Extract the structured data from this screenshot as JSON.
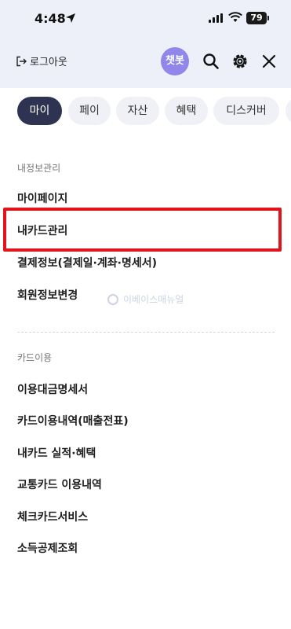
{
  "status_bar": {
    "time": "4:48",
    "battery": "79"
  },
  "header": {
    "logout_label": "로그아웃",
    "chatbot_label": "챗봇"
  },
  "tabs": [
    {
      "label": "마이"
    },
    {
      "label": "페이"
    },
    {
      "label": "자산"
    },
    {
      "label": "혜택"
    },
    {
      "label": "디스커버"
    }
  ],
  "sections": [
    {
      "title": "내정보관리",
      "items": [
        {
          "label": "마이페이지"
        },
        {
          "label": "내카드관리"
        },
        {
          "label": "결제정보(결제일·계좌·명세서)"
        },
        {
          "label": "회원정보변경"
        }
      ]
    },
    {
      "title": "카드이용",
      "items": [
        {
          "label": "이용대금명세서"
        },
        {
          "label": "카드이용내역(매출전표)"
        },
        {
          "label": "내카드 실적·혜택"
        },
        {
          "label": "교통카드 이용내역"
        },
        {
          "label": "체크카드서비스"
        },
        {
          "label": "소득공제조회"
        }
      ]
    }
  ],
  "watermark": "이베이스매뉴얼",
  "colors": {
    "highlight": "#e0141a",
    "active_tab": "#2d3350",
    "chatbot": "#8f88ea"
  }
}
